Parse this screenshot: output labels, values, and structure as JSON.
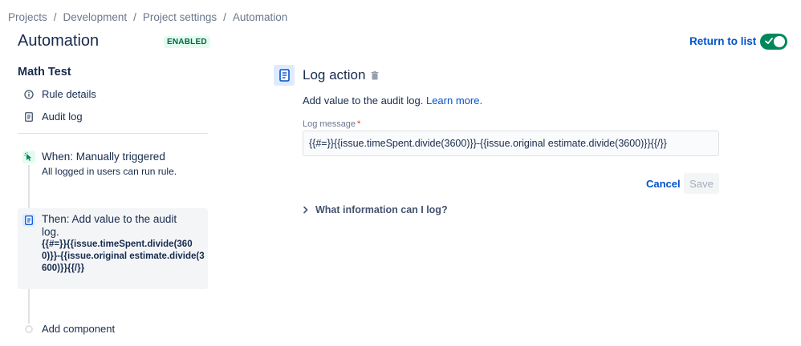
{
  "breadcrumb": {
    "items": [
      "Projects",
      "Development",
      "Project settings",
      "Automation"
    ],
    "separator": "/"
  },
  "header": {
    "title": "Automation",
    "status_badge": "ENABLED",
    "return_link": "Return to list",
    "toggle_on": true
  },
  "sidebar": {
    "rule_name": "Math Test",
    "items": [
      {
        "label": "Rule details",
        "icon": "info-icon"
      },
      {
        "label": "Audit log",
        "icon": "document-icon"
      }
    ],
    "trigger": {
      "title": "When: Manually triggered",
      "subtitle": "All logged in users can run rule.",
      "icon": "cursor-click-icon"
    },
    "action": {
      "title": "Then: Add value to the audit log.",
      "detail": "{{#=}}{{issue.timeSpent.divide(3600)}}-{{issue.original estimate.divide(3600)}}{{/}}",
      "icon": "document-icon"
    },
    "add_component": "Add component"
  },
  "main": {
    "title": "Log action",
    "description": "Add value to the audit log.",
    "learn_more": "Learn more.",
    "field_label": "Log message",
    "required_mark": "*",
    "log_message_value": "{{#=}}{{issue.timeSpent.divide(3600)}}-{{issue.original estimate.divide(3600)}}{{/}}",
    "cancel_label": "Cancel",
    "save_label": "Save",
    "expander_label": "What information can I log?"
  },
  "colors": {
    "accent": "#0052cc",
    "toggle_green": "#00875a",
    "badge_bg": "#e3fcef",
    "badge_text": "#006644",
    "required": "#de350b"
  }
}
